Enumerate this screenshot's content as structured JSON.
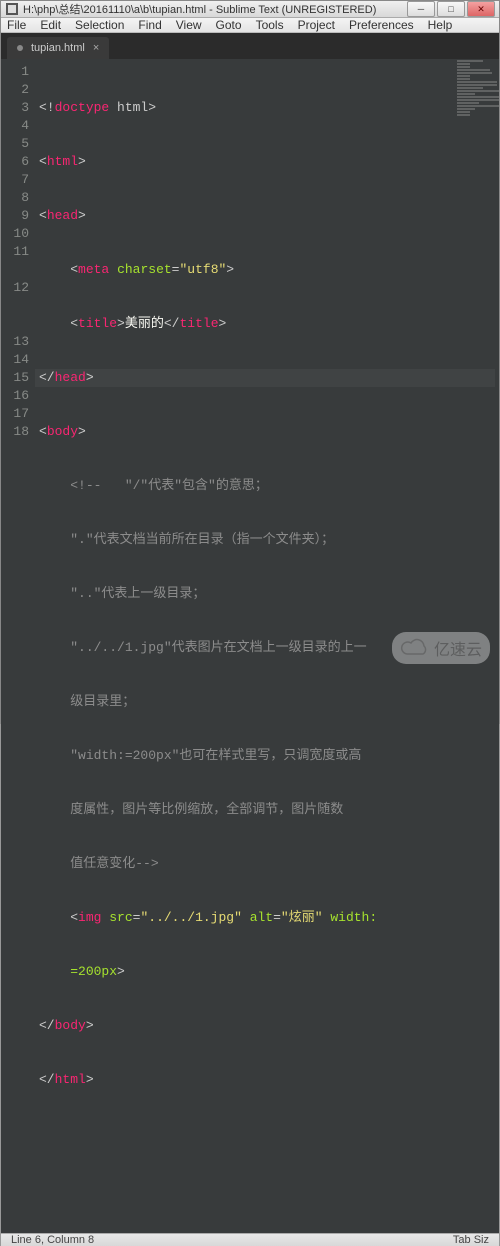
{
  "titlebar": {
    "path": "H:\\php\\总结\\20161110\\a\\b\\tupian.html - Sublime Text (UNREGISTERED)",
    "min": "─",
    "max": "□",
    "close": "✕"
  },
  "menu": {
    "file": "File",
    "edit": "Edit",
    "selection": "Selection",
    "find": "Find",
    "view": "View",
    "goto": "Goto",
    "tools": "Tools",
    "project": "Project",
    "preferences": "Preferences",
    "help": "Help"
  },
  "tab": {
    "name": "tupian.html",
    "close": "×"
  },
  "gutter": {
    "lines": [
      "1",
      "2",
      "3",
      "4",
      "5",
      "6",
      "7",
      "8",
      "9",
      "10",
      "11",
      "",
      "12",
      "",
      "13",
      "14",
      "15",
      "16",
      "17",
      "18"
    ]
  },
  "code": {
    "r1": {
      "a": "<!",
      "b": "doctype",
      "c": " html",
      "d": ">"
    },
    "r2": {
      "a": "<",
      "b": "html",
      "c": ">"
    },
    "r3": {
      "a": "<",
      "b": "head",
      "c": ">"
    },
    "r4": {
      "pad": "    ",
      "a": "<",
      "b": "meta",
      "sp": " ",
      "c": "charset",
      "eq": "=",
      "d": "\"utf8\"",
      "e": ">"
    },
    "r5": {
      "pad": "    ",
      "a": "<",
      "b": "title",
      "c": ">",
      "d": "美丽的",
      "e": "</",
      "f": "title",
      "g": ">"
    },
    "r6": {
      "a": "</",
      "b": "head",
      "c": ">"
    },
    "r7": {
      "a": "<",
      "b": "body",
      "c": ">"
    },
    "r8": {
      "pad": "    ",
      "a": "<!--   \"/\"代表\"包含\"的意思；"
    },
    "r9": {
      "pad": "    ",
      "a": "\".\"代表文档当前所在目录（指一个文件夹）；"
    },
    "r10": {
      "pad": "    ",
      "a": "\"..\"代表上一级目录；"
    },
    "r11a": {
      "pad": "    ",
      "a": "\"../../1.jpg\"代表图片在文档上一级目录的上一"
    },
    "r11b": {
      "pad": "    ",
      "a": "级目录里；"
    },
    "r12a": {
      "pad": "    ",
      "a": "\"width:=200px\"也可在样式里写，只调宽度或高"
    },
    "r12b": {
      "pad": "    ",
      "a": "度属性，图片等比例缩放，全部调节，图片随数"
    },
    "r12c": {
      "pad": "    ",
      "a": "值任意变化-->"
    },
    "r13a": {
      "pad": "    ",
      "a": "<",
      "b": "img",
      "sp": " ",
      "c": "src",
      "eq": "=",
      "d": "\"../../1.jpg\"",
      "sp2": " ",
      "e": "alt",
      "eq2": "=",
      "f": "\"炫丽\"",
      "sp3": " ",
      "g": "width:"
    },
    "r13b": {
      "pad": "    ",
      "a": "=200px",
      "b": ">"
    },
    "r15": {
      "a": "</",
      "b": "body",
      "c": ">"
    },
    "r16": {
      "a": "</",
      "b": "html",
      "c": ">"
    }
  },
  "status": {
    "left": "Line 6, Column 8",
    "right": "Tab Siz"
  },
  "watermark": {
    "text": "亿速云"
  }
}
